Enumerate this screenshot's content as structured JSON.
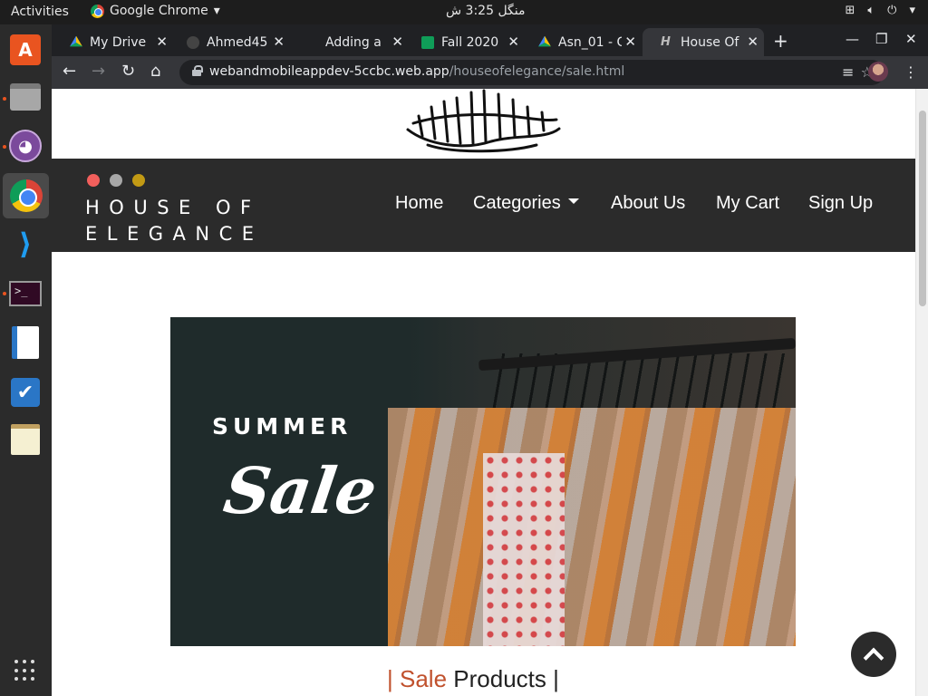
{
  "system": {
    "activities_label": "Activities",
    "app_menu_label": "Google Chrome",
    "clock": "منگل 3:25 ش"
  },
  "browser": {
    "tabs": [
      {
        "title": "My Drive",
        "icon": "drive-icon"
      },
      {
        "title": "Ahmed45",
        "icon": "github-icon"
      },
      {
        "title": "Adding a",
        "icon": "blank-icon"
      },
      {
        "title": "Fall 2020",
        "icon": "sheets-icon"
      },
      {
        "title": "Asn_01 - G",
        "icon": "drive-icon"
      },
      {
        "title": "House Of",
        "icon": "h-icon",
        "active": true
      }
    ],
    "url_host": "webandmobileappdev-5ccbc.web.app",
    "url_path": "/houseofelegance/sale.html"
  },
  "site": {
    "brand_line1": "HOUSE OF",
    "brand_line2": "ELEGANCE",
    "dot_colors": [
      "#f25f5c",
      "#a7a7a7",
      "#c29a14"
    ],
    "nav": {
      "home": "Home",
      "categories": "Categories",
      "about": "About Us",
      "cart": "My Cart",
      "signup": "Sign Up"
    },
    "banner": {
      "summer": "SUMMER",
      "sale": "Sale"
    },
    "heading": {
      "bar_left": "|",
      "accent": "Sale",
      "rest": "Products",
      "bar_right": "|"
    }
  }
}
